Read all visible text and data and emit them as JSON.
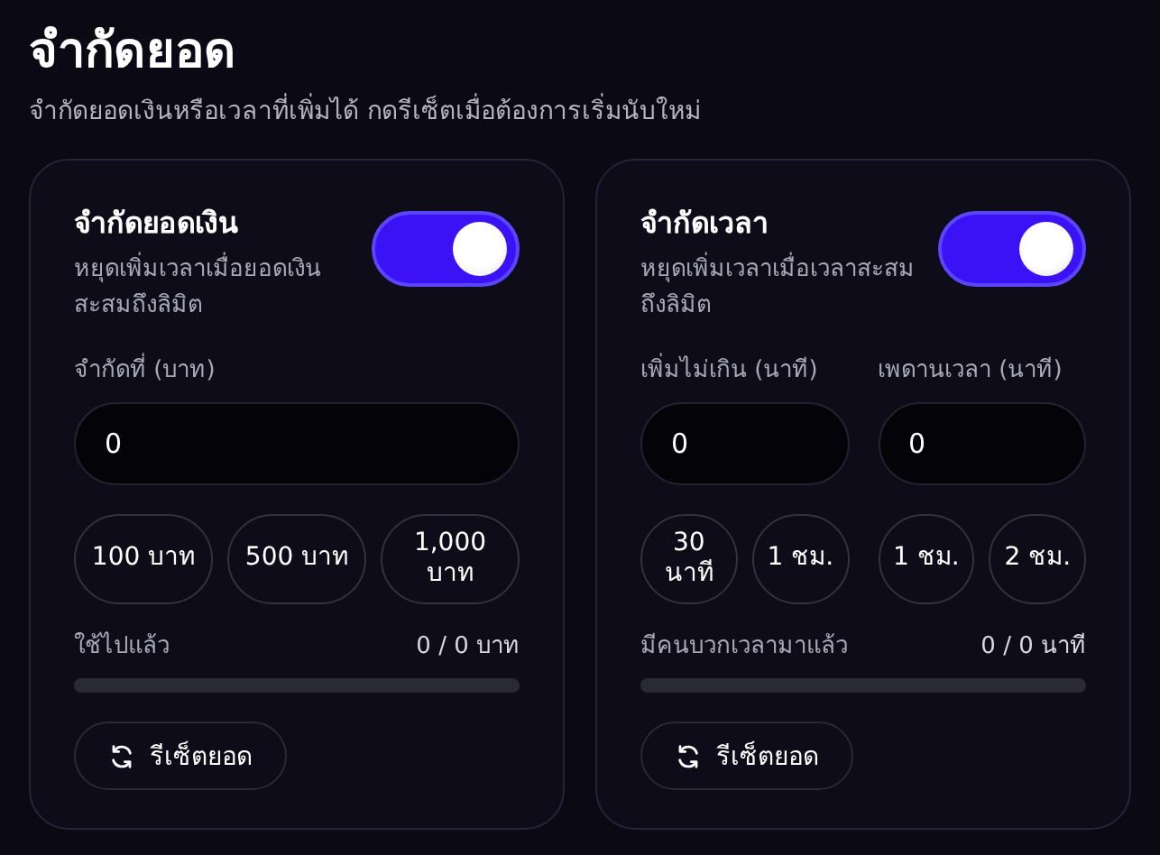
{
  "header": {
    "title": "จำกัดยอด",
    "subtitle": "จำกัดยอดเงินหรือเวลาที่เพิ่มได้ กดรีเซ็ตเมื่อต้องการเริ่มนับใหม่"
  },
  "cards": [
    {
      "title": "จำกัดยอดเงิน",
      "description": "หยุดเพิ่มเวลาเมื่อยอดเงินสะสมถึงลิมิต",
      "on": true,
      "fields": [
        {
          "label": "จำกัดที่ (บาท)",
          "value": "0",
          "presets": [
            "100 บาท",
            "500 บาท",
            "1,000 บาท"
          ]
        }
      ],
      "usage": {
        "label": "ใช้ไปแล้ว",
        "reading": "0 / 0 บาท",
        "level": 0
      },
      "reset_button": "รีเซ็ตยอด"
    },
    {
      "title": "จำกัดเวลา",
      "description": "หยุดเพิ่มเวลาเมื่อเวลาสะสมถึงลิมิต",
      "on": true,
      "fields": [
        {
          "label": "เพิ่มไม่เกิน (นาที)",
          "value": "0",
          "presets": [
            "30 นาที",
            "1 ชม."
          ]
        },
        {
          "label": "เพดานเวลา (นาที)",
          "value": "0",
          "presets": [
            "1 ชม.",
            "2 ชม."
          ]
        }
      ],
      "usage": {
        "label": "มีคนบวกเวลามาแล้ว",
        "reading": "0 / 0 นาที",
        "level": 0
      },
      "reset_button": "รีเซ็ตยอด"
    }
  ]
}
